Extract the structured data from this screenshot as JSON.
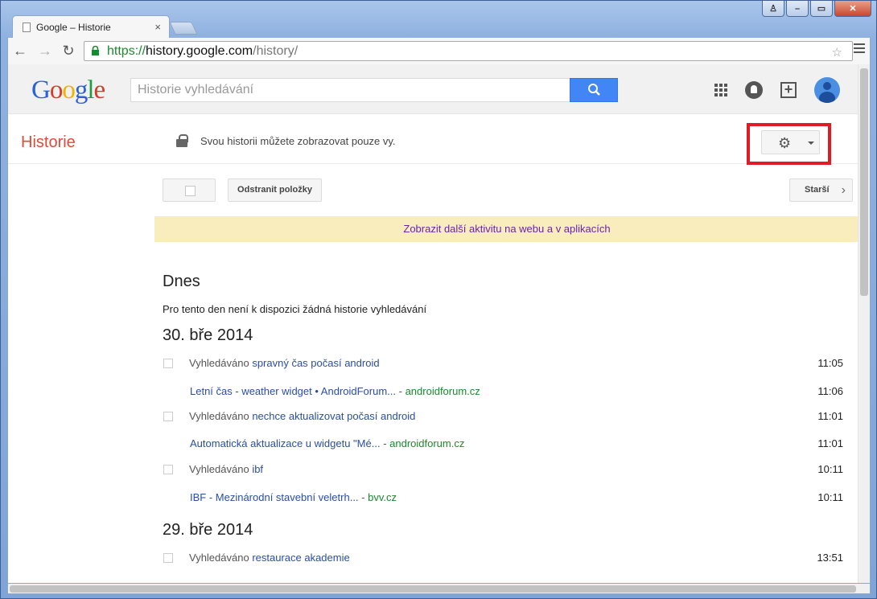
{
  "browser": {
    "tab_title": "Google – Historie",
    "tab_close": "×",
    "url_scheme": "https://",
    "url_host": "history.google.com",
    "url_path": "/history/"
  },
  "header": {
    "logo": [
      "G",
      "o",
      "o",
      "g",
      "l",
      "e"
    ],
    "search_placeholder": "Historie vyhledávání"
  },
  "subbar": {
    "title": "Historie",
    "privacy_text": "Svou historii můžete zobrazovat pouze vy."
  },
  "actions": {
    "remove_label": "Odstranit položky",
    "older_label": "Starší"
  },
  "banner": "Zobrazit další aktivitu na webu a v aplikacích",
  "sections": [
    {
      "date": "Dnes",
      "note": "Pro tento den není k dispozici žádná historie vyhledávání"
    },
    {
      "date": "30. bře 2014",
      "items": [
        {
          "kind": "search",
          "prefix": "Vyhledáváno",
          "query": "spravný čas počasí android",
          "time": "11:05"
        },
        {
          "kind": "result",
          "title": "Letní čas - weather widget • AndroidForum...",
          "sep": " - ",
          "domain": "androidforum.cz",
          "time": "11:06"
        },
        {
          "kind": "search",
          "prefix": "Vyhledáváno",
          "query": "nechce aktualizovat počasí android",
          "time": "11:01"
        },
        {
          "kind": "result",
          "title": "Automatická aktualizace u widgetu \"Mé...",
          "sep": " - ",
          "domain": "androidforum.cz",
          "time": "11:01"
        },
        {
          "kind": "search",
          "prefix": "Vyhledáváno",
          "query": "ibf",
          "time": "10:11"
        },
        {
          "kind": "result",
          "title": "IBF - Mezinárodní stavební veletrh...",
          "sep": " - ",
          "domain": "bvv.cz",
          "time": "10:11"
        }
      ]
    },
    {
      "date": "29. bře 2014",
      "items": [
        {
          "kind": "search",
          "prefix": "Vyhledáváno",
          "query": "restaurace akademie",
          "time": "13:51"
        }
      ]
    }
  ]
}
